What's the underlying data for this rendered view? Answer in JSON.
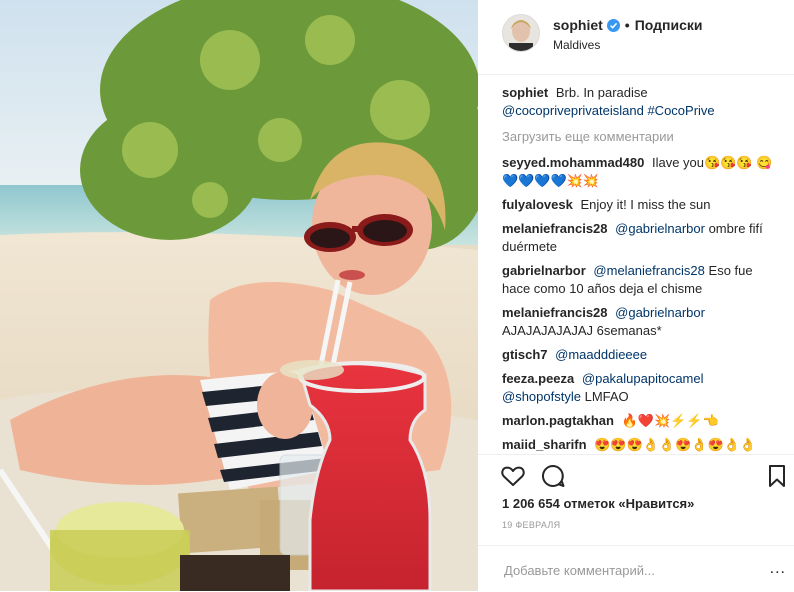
{
  "post": {
    "username": "sophiet",
    "follow_label": "Подписки",
    "location": "Maldives",
    "caption_user": "sophiet",
    "caption_text": "Brb. In paradise",
    "caption_mention": "@cocopriveprivateisland",
    "caption_hashtag": "#CocoPrive",
    "load_more": "Загрузить еще комментарии",
    "likes": "1 206 654 отметок «Нравится»",
    "date": "19 ФЕВРАЛЯ",
    "comment_placeholder": "Добавьте комментарий...",
    "more_dots": "..."
  },
  "comments": [
    {
      "user": "seyyed.mohammad480",
      "text": "Ilave you😘😘😘 😋💙💙💙💙💥💥"
    },
    {
      "user": "fulyalovesk",
      "text": "Enjoy it! I miss the sun"
    },
    {
      "user": "melaniefrancis28",
      "mention": "@gabrielnarbor",
      "text": "ombre fifí duérmete"
    },
    {
      "user": "gabrielnarbor",
      "mention": "@melaniefrancis28",
      "text": "Eso fue hace como 10 años deja el chisme"
    },
    {
      "user": "melaniefrancis28",
      "mention": "@gabrielnarbor",
      "text": "AJAJAJAJAJAJ 6semanas*"
    },
    {
      "user": "gtisch7",
      "mention": "@maadddieeee",
      "text": ""
    },
    {
      "user": "feeza.peeza",
      "mention": "@pakalupapitocamel",
      "mention2": "@shopofstyle",
      "text": "LMFAO"
    },
    {
      "user": "marlon.pagtakhan",
      "text": "🔥❤️💥⚡⚡👈"
    },
    {
      "user": "maiid_sharifn",
      "text": "😍😍😍👌👌😍👌😍👌👌"
    }
  ],
  "colors": {
    "accent": "#3897f0",
    "mention": "#003569",
    "muted": "#999999"
  },
  "icons": [
    "heart-icon",
    "comment-icon",
    "bookmark-icon",
    "verified-icon"
  ]
}
